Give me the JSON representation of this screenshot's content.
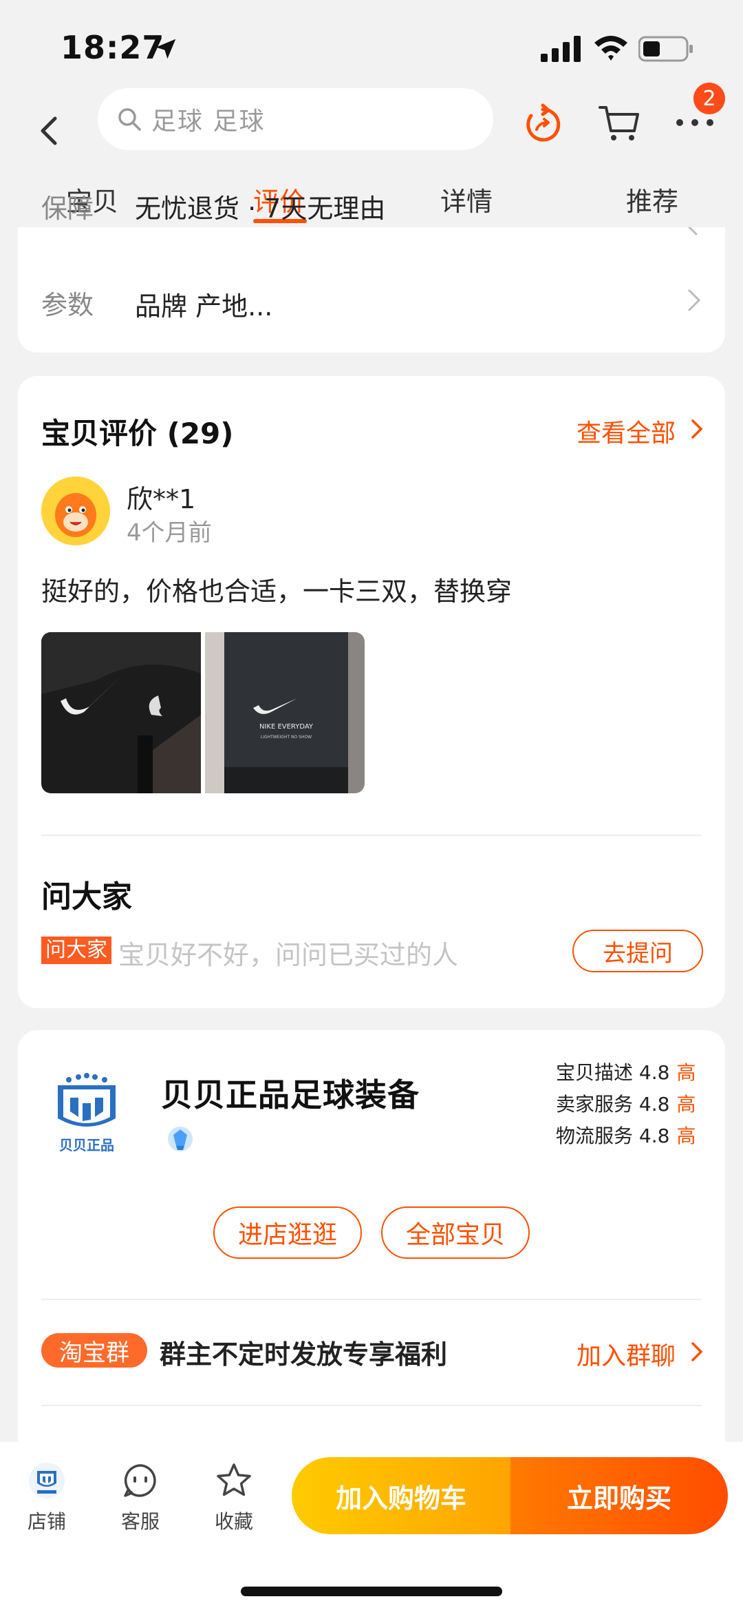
{
  "status_bar": {
    "time": "18:27"
  },
  "nav": {
    "search_placeholder": "足球 足球",
    "cart_badge": "2"
  },
  "tabs": [
    {
      "label": "宝贝"
    },
    {
      "label": "评价",
      "active": true
    },
    {
      "label": "详情"
    },
    {
      "label": "推荐"
    }
  ],
  "info": {
    "guarantee_label": "保障",
    "guarantee_value": "无忧退货 · 7天无理由",
    "params_label": "参数",
    "params_value": "品牌 产地..."
  },
  "reviews": {
    "title": "宝贝评价 (29)",
    "view_all": "查看全部",
    "user": "欣**1",
    "time": "4个月前",
    "text": "挺好的，价格也合适，一卡三双，替换穿",
    "photo2_brand": "NIKE EVERYDAY",
    "photo2_sub": "LIGHTWEIGHT NO SHOW"
  },
  "ask": {
    "title": "问大家",
    "tag": "问大家",
    "placeholder": "宝贝好不好，问问已买过的人",
    "button": "去提问"
  },
  "shop": {
    "logo_text": "贝贝正品",
    "name": "贝贝正品足球装备",
    "ratings": [
      {
        "label": "宝贝描述 4.8",
        "level": "高"
      },
      {
        "label": "卖家服务 4.8",
        "level": "高"
      },
      {
        "label": "物流服务 4.8",
        "level": "高"
      }
    ],
    "enter_button": "进店逛逛",
    "all_button": "全部宝贝",
    "group_tag": "淘宝群",
    "group_text": "群主不定时发放专享福利",
    "join": "加入群聊"
  },
  "bottom_bar": {
    "store": "店铺",
    "service": "客服",
    "favorite": "收藏",
    "add_cart": "加入购物车",
    "buy_now": "立即购买"
  },
  "colors": {
    "accent": "#ff5000",
    "cart_button": "#ffb000",
    "buy_button": "#ff5a00"
  }
}
